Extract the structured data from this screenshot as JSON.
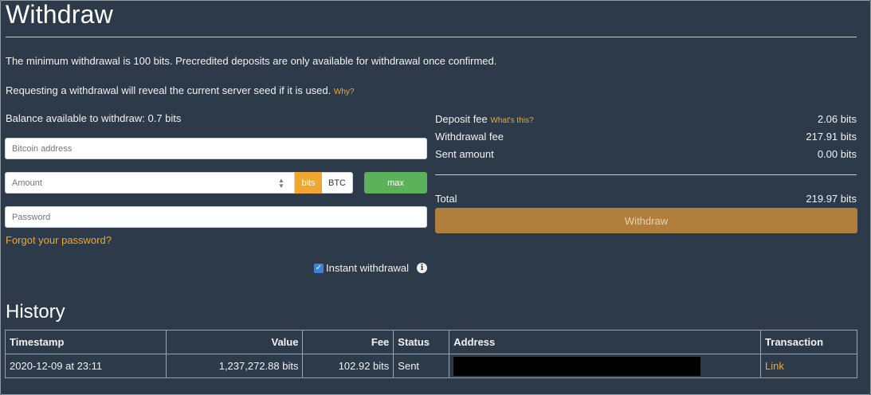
{
  "title": "Withdraw",
  "notes": {
    "minimum": "The minimum withdrawal is 100 bits. Precredited deposits are only available for withdrawal once confirmed.",
    "reveal": "Requesting a withdrawal will reveal the current server seed if it is used.",
    "why_link": "Why?"
  },
  "balance_label": "Balance available to withdraw: 0.7 bits",
  "form": {
    "bitcoin_address_placeholder": "Bitcoin address",
    "amount_placeholder": "Amount",
    "unit_bits": "bits",
    "unit_btc": "BTC",
    "max_label": "max",
    "password_placeholder": "Password",
    "forgot_password": "Forgot your password?",
    "instant_withdrawal_label": "Instant withdrawal",
    "instant_withdrawal_checked": true
  },
  "summary": {
    "deposit_fee_label": "Deposit fee",
    "whats_this": "What's this?",
    "deposit_fee_value": "2.06 bits",
    "withdrawal_fee_label": "Withdrawal fee",
    "withdrawal_fee_value": "217.91 bits",
    "sent_amount_label": "Sent amount",
    "sent_amount_value": "0.00 bits",
    "total_label": "Total",
    "total_value": "219.97 bits",
    "withdraw_button": "Withdraw"
  },
  "history": {
    "title": "History",
    "columns": [
      "Timestamp",
      "Value",
      "Fee",
      "Status",
      "Address",
      "Transaction"
    ],
    "rows": [
      {
        "timestamp": "2020-12-09 at 23:11",
        "value": "1,237,272.88 bits",
        "fee": "102.92 bits",
        "status": "Sent",
        "transaction": "Link"
      }
    ]
  },
  "colors": {
    "background": "#2c3a4a",
    "accent_orange": "#f0a732",
    "max_green": "#5cb15b",
    "withdraw_button": "#b07f3d"
  },
  "icons": {
    "info": "info-icon",
    "checkbox": "checkbox-checked-icon",
    "spinner": "number-spinner-icon"
  }
}
